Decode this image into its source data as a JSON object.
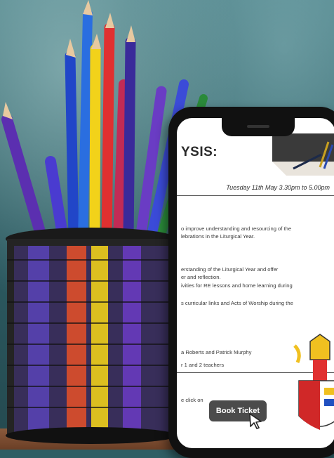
{
  "screen": {
    "title": "YSIS:",
    "date": "Tuesday 11th May 3.30pm to 5.00pm",
    "lines": [
      "o improve understanding and resourcing of the",
      "lebrations in the Liturgical Year.",
      "erstanding of the Liturgical Year and offer",
      "er and reflection.",
      "ivities for RE lessons and home learning during",
      "s curricular links and Acts of Worship during the",
      "a Roberts and Patrick Murphy",
      "r 1 and 2 teachers"
    ],
    "click_prompt": "e click on",
    "button_label": "Book Ticket"
  },
  "icons": {
    "cursor": "mouse-pointer-icon",
    "crest": "diocesan-crest-icon",
    "corner": "desk-pencils-graphic"
  },
  "colors": {
    "button": "#4b4b4b",
    "background": "#2f5e64"
  }
}
